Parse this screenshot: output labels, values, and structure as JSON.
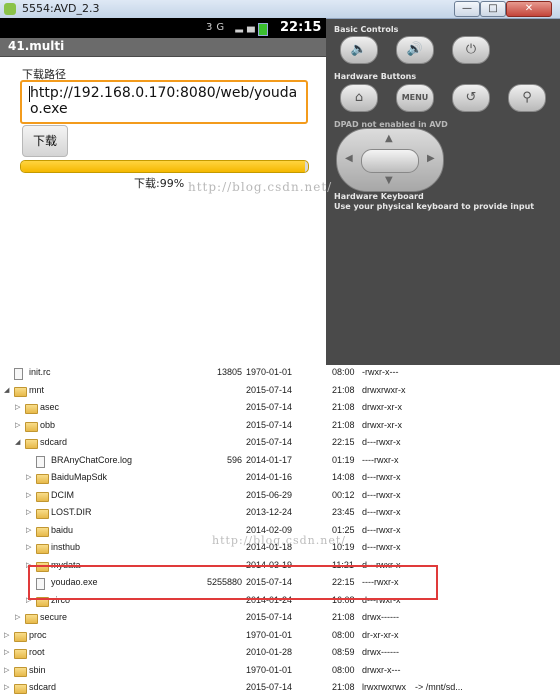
{
  "window": {
    "title": "5554:AVD_2.3",
    "min": "—",
    "max": "□",
    "close": "✕"
  },
  "phone": {
    "status_time": "22:15",
    "status_icons": "3G ▂▄▆",
    "app_title": "41.multi",
    "path_label": "下载路径",
    "url_value": "http://192.168.0.170:8080/web/youdao.exe",
    "download_button": "下载",
    "progress_percent": 99,
    "progress_text": "下载:99%"
  },
  "controls": {
    "basic_title": "Basic Controls",
    "basic": [
      {
        "icon": "volume-down-icon",
        "glyph": "🔈"
      },
      {
        "icon": "volume-up-icon",
        "glyph": "🔊"
      },
      {
        "icon": "power-icon",
        "glyph": "⏻"
      }
    ],
    "hardware_title": "Hardware Buttons",
    "hardware": [
      {
        "icon": "home-icon",
        "glyph": "⌂"
      },
      {
        "icon": "menu",
        "glyph": "MENU"
      },
      {
        "icon": "back-icon",
        "glyph": "↺"
      },
      {
        "icon": "search-icon",
        "glyph": "⚲"
      }
    ],
    "dpad_title": "DPAD not enabled in AVD",
    "keyboard_title": "Hardware Keyboard",
    "keyboard_hint": "Use your physical keyboard to provide input"
  },
  "watermarks": {
    "top": "http://blog.csdn.net/",
    "bottom": "http://blog.csdn.net/"
  },
  "explorer": {
    "rows": [
      {
        "indent": 0,
        "exp": "",
        "type": "file",
        "name": "init.rc",
        "size": "13805",
        "date": "1970-01-01",
        "time": "08:00",
        "perm": "-rwxr-x---",
        "info": ""
      },
      {
        "indent": 0,
        "exp": "◢",
        "type": "folder",
        "name": "mnt",
        "size": "",
        "date": "2015-07-14",
        "time": "21:08",
        "perm": "drwxrwxr-x",
        "info": ""
      },
      {
        "indent": 1,
        "exp": "▷",
        "type": "folder",
        "name": "asec",
        "size": "",
        "date": "2015-07-14",
        "time": "21:08",
        "perm": "drwxr-xr-x",
        "info": ""
      },
      {
        "indent": 1,
        "exp": "▷",
        "type": "folder",
        "name": "obb",
        "size": "",
        "date": "2015-07-14",
        "time": "21:08",
        "perm": "drwxr-xr-x",
        "info": ""
      },
      {
        "indent": 1,
        "exp": "◢",
        "type": "folder",
        "name": "sdcard",
        "size": "",
        "date": "2015-07-14",
        "time": "22:15",
        "perm": "d---rwxr-x",
        "info": ""
      },
      {
        "indent": 2,
        "exp": "",
        "type": "file",
        "name": "BRAnyChatCore.log",
        "size": "596",
        "date": "2014-01-17",
        "time": "01:19",
        "perm": "----rwxr-x",
        "info": ""
      },
      {
        "indent": 2,
        "exp": "▷",
        "type": "folder",
        "name": "BaiduMapSdk",
        "size": "",
        "date": "2014-01-16",
        "time": "14:08",
        "perm": "d---rwxr-x",
        "info": ""
      },
      {
        "indent": 2,
        "exp": "▷",
        "type": "folder",
        "name": "DCIM",
        "size": "",
        "date": "2015-06-29",
        "time": "00:12",
        "perm": "d---rwxr-x",
        "info": ""
      },
      {
        "indent": 2,
        "exp": "▷",
        "type": "folder",
        "name": "LOST.DIR",
        "size": "",
        "date": "2013-12-24",
        "time": "23:45",
        "perm": "d---rwxr-x",
        "info": ""
      },
      {
        "indent": 2,
        "exp": "▷",
        "type": "folder",
        "name": "baidu",
        "size": "",
        "date": "2014-02-09",
        "time": "01:25",
        "perm": "d---rwxr-x",
        "info": ""
      },
      {
        "indent": 2,
        "exp": "▷",
        "type": "folder",
        "name": "insthub",
        "size": "",
        "date": "2014-01-18",
        "time": "10:19",
        "perm": "d---rwxr-x",
        "info": ""
      },
      {
        "indent": 2,
        "exp": "▷",
        "type": "folder",
        "name": "mydata",
        "size": "",
        "date": "2014-03-19",
        "time": "11:21",
        "perm": "d---rwxr-x",
        "info": ""
      },
      {
        "indent": 2,
        "exp": "",
        "type": "file",
        "name": "youdao.exe",
        "size": "5255880",
        "date": "2015-07-14",
        "time": "22:15",
        "perm": "----rwxr-x",
        "info": ""
      },
      {
        "indent": 2,
        "exp": "▷",
        "type": "folder",
        "name": "zirco",
        "size": "",
        "date": "2014-01-24",
        "time": "16:08",
        "perm": "d---rwxr-x",
        "info": ""
      },
      {
        "indent": 1,
        "exp": "▷",
        "type": "folder",
        "name": "secure",
        "size": "",
        "date": "2015-07-14",
        "time": "21:08",
        "perm": "drwx------",
        "info": ""
      },
      {
        "indent": 0,
        "exp": "▷",
        "type": "folder",
        "name": "proc",
        "size": "",
        "date": "1970-01-01",
        "time": "08:00",
        "perm": "dr-xr-xr-x",
        "info": ""
      },
      {
        "indent": 0,
        "exp": "▷",
        "type": "folder",
        "name": "root",
        "size": "",
        "date": "2010-01-28",
        "time": "08:59",
        "perm": "drwx------",
        "info": ""
      },
      {
        "indent": 0,
        "exp": "▷",
        "type": "folder",
        "name": "sbin",
        "size": "",
        "date": "1970-01-01",
        "time": "08:00",
        "perm": "drwxr-x---",
        "info": ""
      },
      {
        "indent": 0,
        "exp": "▷",
        "type": "folder",
        "name": "sdcard",
        "size": "",
        "date": "2015-07-14",
        "time": "21:08",
        "perm": "lrwxrwxrwx",
        "info": "-> /mnt/sd..."
      }
    ]
  }
}
